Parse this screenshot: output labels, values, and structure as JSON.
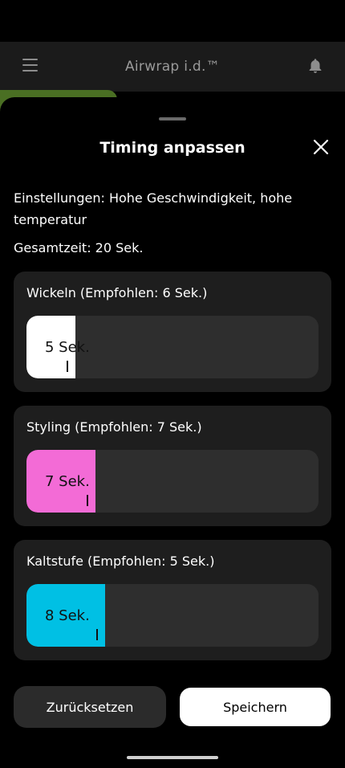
{
  "app": {
    "title": "Airwrap i.d.™"
  },
  "sheet": {
    "title": "Timing anpassen",
    "settings": "Einstellungen: Hohe Geschwindigkeit, hohe temperatur",
    "total_time": "Gesamtzeit: 20 Sek."
  },
  "stages": [
    {
      "label": "Wickeln (Empfohlen: 6 Sek.)",
      "value_text": "5 Sek.",
      "seconds": 5,
      "fill_fraction": 0.168,
      "color": "#ffffff"
    },
    {
      "label": "Styling (Empfohlen: 7 Sek.)",
      "value_text": "7 Sek.",
      "seconds": 7,
      "fill_fraction": 0.236,
      "color": "#f36bd6"
    },
    {
      "label": "Kaltstufe (Empfohlen: 5 Sek.)",
      "value_text": "8 Sek.",
      "seconds": 8,
      "fill_fraction": 0.269,
      "color": "#00c0e4"
    }
  ],
  "buttons": {
    "reset_label": "Zurücksetzen",
    "save_label": "Speichern"
  },
  "icons": {
    "menu": "menu-icon",
    "notifications": "bell-icon",
    "close": "close-icon"
  }
}
